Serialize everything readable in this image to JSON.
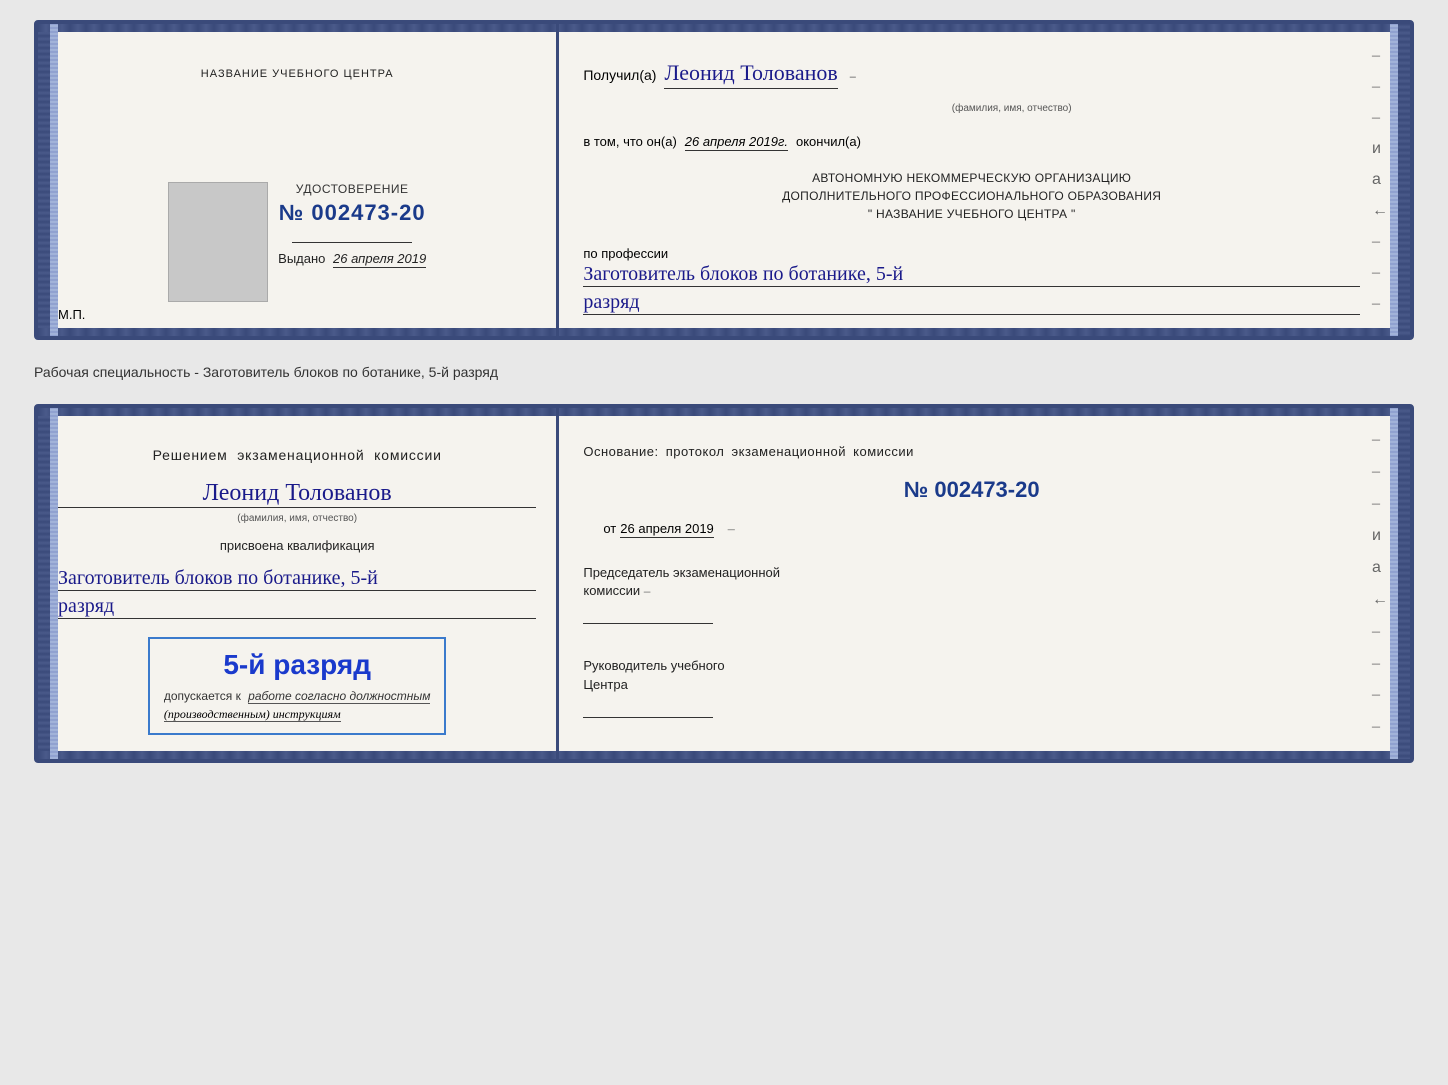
{
  "top_doc": {
    "left": {
      "title": "НАЗВАНИЕ УЧЕБНОГО ЦЕНТРА",
      "cert_label": "УДОСТОВЕРЕНИЕ",
      "cert_number": "№ 002473-20",
      "issued_label": "Выдано",
      "issued_date": "26 апреля 2019",
      "mp_label": "М.П."
    },
    "right": {
      "received_prefix": "Получил(а)",
      "received_name": "Леонид Толованов",
      "name_sublabel": "(фамилия, имя, отчество)",
      "confirm_prefix": "в том, что он(а)",
      "confirm_date": "26 апреля 2019г.",
      "confirm_suffix": "окончил(а)",
      "org_line1": "АВТОНОМНУЮ НЕКОММЕРЧЕСКУЮ ОРГАНИЗАЦИЮ",
      "org_line2": "ДОПОЛНИТЕЛЬНОГО ПРОФЕССИОНАЛЬНОГО ОБРАЗОВАНИЯ",
      "org_line3": "\" НАЗВАНИЕ УЧЕБНОГО ЦЕНТРА \"",
      "profession_label": "по профессии",
      "profession_name": "Заготовитель блоков по ботанике, 5-й",
      "rank": "разряд",
      "dash_marks": [
        "–",
        "–",
        "–",
        "и",
        "а",
        "←",
        "–",
        "–",
        "–"
      ]
    }
  },
  "separator": {
    "text": "Рабочая специальность - Заготовитель блоков по ботанике, 5-й разряд"
  },
  "bottom_doc": {
    "left": {
      "decision_text": "Решением экзаменационной комиссии",
      "person_name": "Леонид Толованов",
      "name_sublabel": "(фамилия, имя, отчество)",
      "assigned_label": "присвоена квалификация",
      "profession_name": "Заготовитель блоков по ботанике, 5-й",
      "rank": "разряд",
      "stamp_rank": "5-й разряд",
      "allowed_prefix": "допускается к",
      "allowed_text": "работе согласно должностным",
      "allowed_text2": "(производственным) инструкциям"
    },
    "right": {
      "basis_title": "Основание: протокол экзаменационной комиссии",
      "protocol_number": "№ 002473-20",
      "date_prefix": "от",
      "date_value": "26 апреля 2019",
      "chair_label": "Председатель экзаменационной",
      "chair_label2": "комиссии",
      "center_head_label": "Руководитель учебного",
      "center_head_label2": "Центра",
      "dash_marks": [
        "–",
        "–",
        "–",
        "и",
        "а",
        "←",
        "–",
        "–",
        "–",
        "–"
      ]
    }
  }
}
